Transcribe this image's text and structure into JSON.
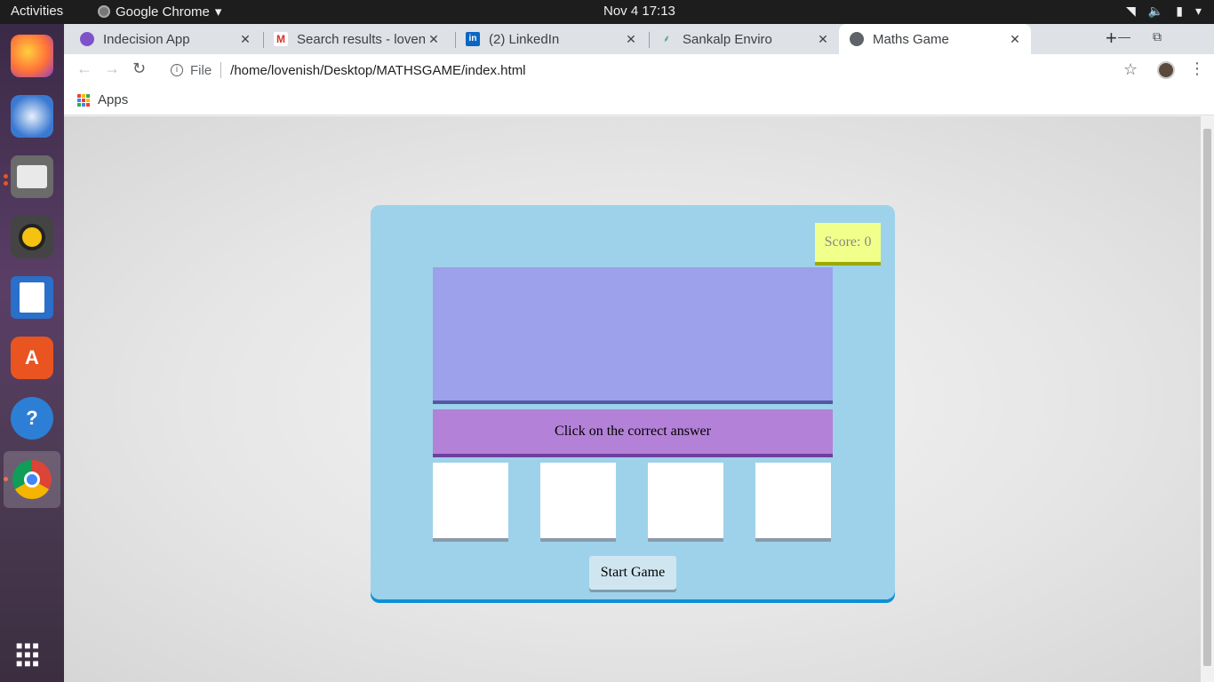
{
  "topbar": {
    "activities": "Activities",
    "app_name": "Google Chrome",
    "clock": "Nov 4  17:13",
    "tray_icons": [
      "wifi-icon",
      "volume-icon",
      "battery-icon",
      "power-menu-icon"
    ]
  },
  "dock": {
    "apps": [
      "firefox",
      "thunderbird",
      "files",
      "rhythmbox",
      "libreoffice-writer",
      "ubuntu-software",
      "help",
      "google-chrome",
      "show-applications"
    ]
  },
  "tabs": [
    {
      "title": "Indecision App",
      "favicon": "purple-circle"
    },
    {
      "title": "Search results - lovenis",
      "favicon": "gmail"
    },
    {
      "title": "(2) LinkedIn",
      "favicon": "linkedin"
    },
    {
      "title": "Sankalp Enviro",
      "favicon": "leaf"
    },
    {
      "title": "Maths Game",
      "favicon": "globe",
      "active": true
    }
  ],
  "toolbar": {
    "scheme_label": "File",
    "url": "/home/lovenish/Desktop/MATHSGAME/index.html"
  },
  "bookmarks": {
    "apps_label": "Apps"
  },
  "game": {
    "score_label": "Score: 0",
    "question": "",
    "instruction": "Click on the correct answer",
    "choices": [
      "",
      "",
      "",
      ""
    ],
    "start_label": "Start Game"
  },
  "colors": {
    "container": "#9dd2ea",
    "score_box": "#f1ff8b",
    "question_box": "#9da0ea",
    "instruction_box": "#b481d8"
  }
}
